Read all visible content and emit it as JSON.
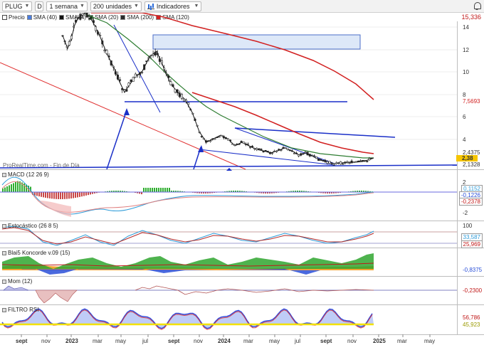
{
  "toolbar": {
    "ticker": "PLUG",
    "d_label": "D",
    "timeframe": "1 semana",
    "units": "200 unidades",
    "indicators": "Indicadores"
  },
  "legend": {
    "price_label": "Precio",
    "sma_labels": [
      "SMA (40)",
      "SMA (4)",
      "SMA (20)",
      "SMA (200)",
      "SMA (120)"
    ],
    "sma_colors": [
      "#4a7de0",
      "#111111",
      "#2e7d32",
      "#2a2a2a",
      "#d22020"
    ]
  },
  "price_axis": {
    "last_close": "15,336",
    "ticks": [
      "14",
      "12",
      "10",
      "8",
      "6",
      "4"
    ],
    "labels": {
      "sma120": "7,5693",
      "upper": "2,4375",
      "current": "2,38",
      "lower": "2,1328"
    }
  },
  "watermark": "ProRealTime.com - Fin de Día",
  "panels": {
    "macd": {
      "title": "MACD (12 26 9)",
      "ticks": [
        "2",
        "0",
        "-2"
      ],
      "values": [
        "0,1152",
        "-0,1226",
        "-0,2378"
      ]
    },
    "stoch": {
      "title": "Estocástico (26 8 5)",
      "ticks": [
        "100",
        "0"
      ],
      "values": [
        "33,587",
        "25,969"
      ]
    },
    "blai5": {
      "title": "Blai5 Koncorde v.09 (15)",
      "values": [
        "-0,8375"
      ]
    },
    "mom": {
      "title": "Mom (12)",
      "values": [
        "-0,2300"
      ]
    },
    "rsi": {
      "title": "FILTRO RSI",
      "values": [
        "56,786",
        "45,923"
      ]
    }
  },
  "x_axis": {
    "labels": [
      "sept",
      "nov",
      "2023",
      "mar",
      "may",
      "jul",
      "sept",
      "nov",
      "2024",
      "mar",
      "may",
      "jul",
      "sept",
      "nov",
      "2025",
      "mar",
      "may"
    ]
  },
  "colors": {
    "sma120": "#d22020",
    "sma20": "#2e7d32",
    "sma4": "#111111",
    "trendline": "#1a2fc8",
    "macd_pos": "#2fae2f",
    "macd_neg": "#c84646",
    "rsi_blue": "#2f4ee0",
    "rsi_red": "#e02020",
    "rsi_yellow": "#f2e100"
  }
}
